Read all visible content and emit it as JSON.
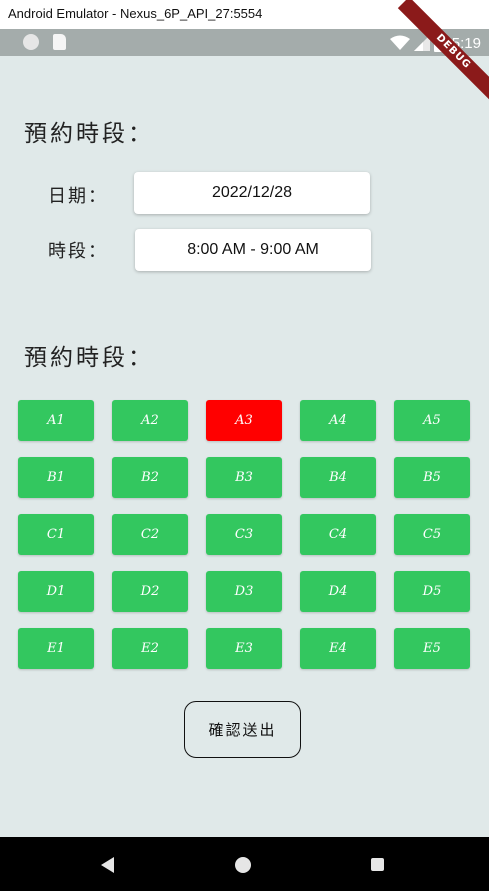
{
  "window": {
    "title": "Android Emulator - Nexus_6P_API_27:5554"
  },
  "status_bar": {
    "time": "5:19"
  },
  "debug_banner": "DEBUG",
  "booking": {
    "section_title": "預約時段：",
    "date_label": "日期：",
    "date_value": "2022/12/28",
    "time_label": "時段：",
    "time_value": "8:00 AM - 9:00 AM"
  },
  "seat_section_title": "預約時段：",
  "slots": [
    [
      "A1",
      "A2",
      "A3",
      "A4",
      "A5"
    ],
    [
      "B1",
      "B2",
      "B3",
      "B4",
      "B5"
    ],
    [
      "C1",
      "C2",
      "C3",
      "C4",
      "C5"
    ],
    [
      "D1",
      "D2",
      "D3",
      "D4",
      "D5"
    ],
    [
      "E1",
      "E2",
      "E3",
      "E4",
      "E5"
    ]
  ],
  "selected_slot": "A3",
  "colors": {
    "slot": "#33c75f",
    "slot_selected": "#ff0000",
    "background": "#e0e9e9"
  },
  "confirm_button": "確認送出",
  "nav": {
    "back": "back-icon",
    "home": "home-icon",
    "recents": "recents-icon"
  }
}
